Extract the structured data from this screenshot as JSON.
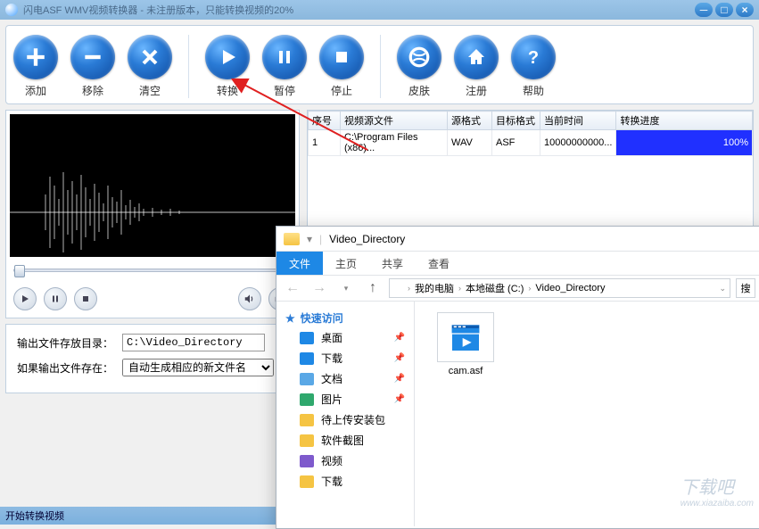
{
  "title": "闪电ASF WMV视频转换器 - 未注册版本，只能转换视频的20%",
  "toolbar": {
    "add": "添加",
    "remove": "移除",
    "clear": "清空",
    "convert": "转换",
    "pause": "暂停",
    "stop": "停止",
    "skin": "皮肤",
    "register": "注册",
    "help": "帮助"
  },
  "table": {
    "headers": {
      "index": "序号",
      "source": "视频源文件",
      "src_fmt": "源格式",
      "dst_fmt": "目标格式",
      "cur_time": "当前时间",
      "progress": "转换进度"
    },
    "rows": [
      {
        "index": "1",
        "source": "C:\\Program Files (x86)...",
        "src_fmt": "WAV",
        "dst_fmt": "ASF",
        "cur_time": "10000000000...",
        "progress": "100%"
      }
    ]
  },
  "output": {
    "dir_label": "输出文件存放目录：",
    "dir_value": "C:\\Video_Directory",
    "exists_label": "如果输出文件存在：",
    "exists_value": "自动生成相应的新文件名"
  },
  "status": "开始转换视频",
  "explorer": {
    "window_title": "Video_Directory",
    "tabs": {
      "file": "文件",
      "home": "主页",
      "share": "共享",
      "view": "查看"
    },
    "breadcrumb": [
      "我的电脑",
      "本地磁盘 (C:)",
      "Video_Directory"
    ],
    "quick_access": "快速访问",
    "sidebar": [
      {
        "label": "桌面",
        "icon": "desktop",
        "pinned": true
      },
      {
        "label": "下载",
        "icon": "download",
        "pinned": true
      },
      {
        "label": "文档",
        "icon": "doc",
        "pinned": true
      },
      {
        "label": "图片",
        "icon": "picture",
        "pinned": true
      },
      {
        "label": "待上传安装包",
        "icon": "folder",
        "pinned": false
      },
      {
        "label": "软件截图",
        "icon": "folder",
        "pinned": false
      },
      {
        "label": "视频",
        "icon": "video",
        "pinned": false
      },
      {
        "label": "下载",
        "icon": "folder",
        "pinned": false
      }
    ],
    "files": [
      {
        "name": "cam.asf"
      }
    ],
    "search_placeholder": "搜"
  },
  "watermark": {
    "main": "下载吧",
    "sub": "www.xiazaiba.com"
  }
}
